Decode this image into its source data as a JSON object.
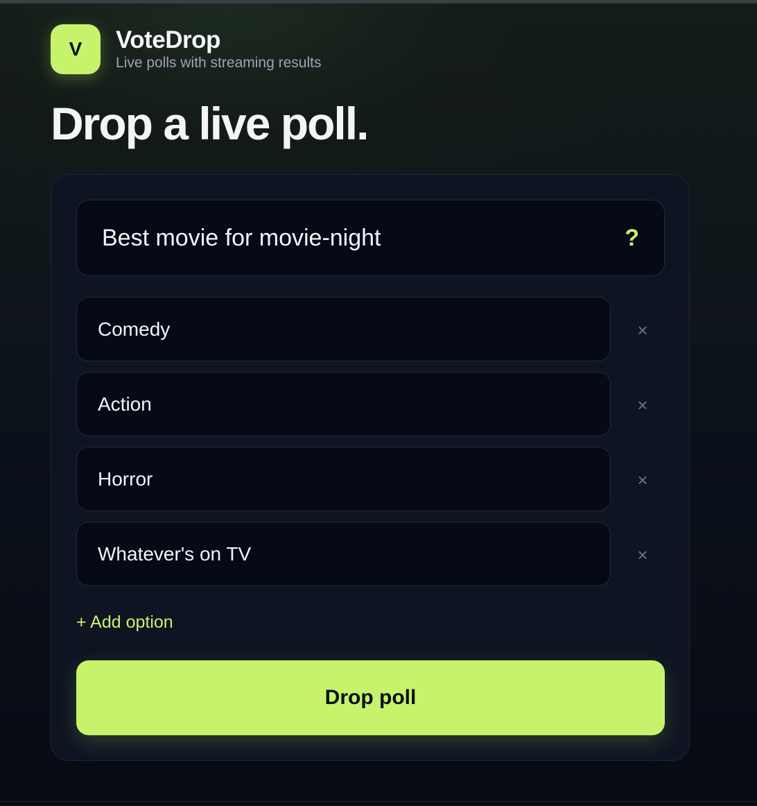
{
  "brand": {
    "logo_letter": "V",
    "name": "VoteDrop",
    "tagline": "Live polls with streaming results"
  },
  "headline": "Drop a live poll.",
  "form": {
    "question_value": "Best movie for movie-night",
    "question_icon": "?",
    "options": [
      {
        "value": "Comedy"
      },
      {
        "value": "Action"
      },
      {
        "value": "Horror"
      },
      {
        "value": "Whatever's on TV"
      }
    ],
    "remove_icon": "×",
    "add_option_label": "+ Add option",
    "submit_label": "Drop poll"
  },
  "colors": {
    "accent": "#c6f36b",
    "background": "#0b111a",
    "card": "#0e1422",
    "field": "#050a16"
  }
}
